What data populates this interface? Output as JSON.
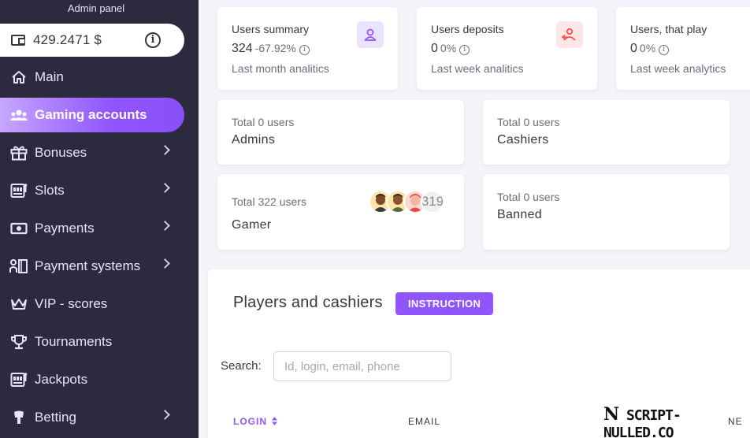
{
  "sidebar": {
    "panel_title": "Admin panel",
    "balance": "429.2471 $",
    "items": [
      {
        "label": "Main",
        "icon": "home-icon"
      },
      {
        "label": "Gaming accounts",
        "icon": "users-icon"
      },
      {
        "label": "Bonuses",
        "icon": "gift-icon"
      },
      {
        "label": "Slots",
        "icon": "slot-machine-icon"
      },
      {
        "label": "Payments",
        "icon": "cash-icon"
      },
      {
        "label": "Payment systems",
        "icon": "payment-systems-icon"
      },
      {
        "label": "VIP - scores",
        "icon": "crown-icon"
      },
      {
        "label": "Tournaments",
        "icon": "trophy-icon"
      },
      {
        "label": "Jackpots",
        "icon": "jackpot-icon"
      },
      {
        "label": "Betting",
        "icon": "betting-icon"
      }
    ]
  },
  "summary": [
    {
      "label": "Users summary",
      "value": "324",
      "pct": "-67.92%",
      "sub": "Last month analitics",
      "badge_color": "#ebe3fe",
      "icon": "user-icon"
    },
    {
      "label": "Users deposits",
      "value": "0",
      "pct": "0%",
      "sub": "Last week analitics",
      "badge_color": "#fde6e6",
      "icon": "user-deposit-icon"
    },
    {
      "label": "Users, that play",
      "value": "0",
      "pct": "0%",
      "sub": "Last week analytics"
    }
  ],
  "roles": {
    "admins": {
      "total": "Total 0 users",
      "name": "Admins"
    },
    "cashiers": {
      "total": "Total 0 users",
      "name": "Cashiers"
    },
    "gamer": {
      "total": "Total 322 users",
      "name": "Gamer",
      "more": "319"
    },
    "banned": {
      "total": "Total 0 users",
      "name": "Banned"
    }
  },
  "players": {
    "title": "Players and cashiers",
    "instruction": "INSTRUCTION",
    "search_label": "Search:",
    "search_placeholder": "Id, login, email, phone",
    "columns": [
      "LOGIN",
      "EMAIL",
      "NE"
    ]
  },
  "watermark": {
    "n": "N",
    "text": "SCRIPT-NULLED.CO"
  },
  "colors": {
    "accent": "#9155fd",
    "sidebar": "#2c2a3f",
    "background": "#f4f5fa"
  }
}
